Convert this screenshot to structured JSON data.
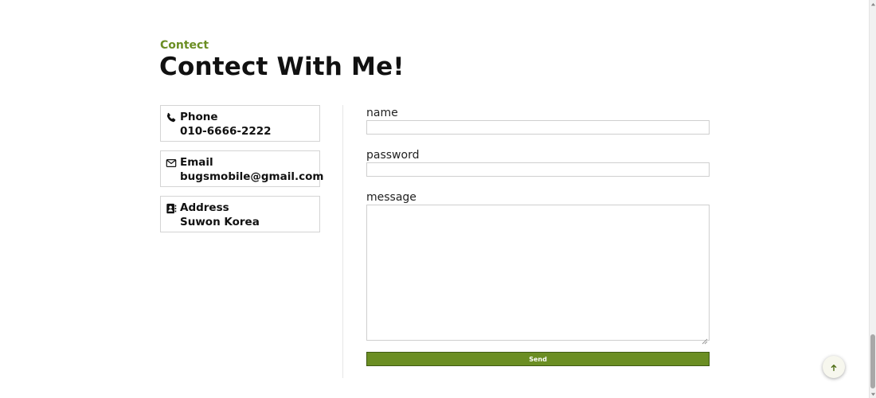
{
  "section": {
    "eyebrow": "Contect",
    "title": "Contect With Me!"
  },
  "contact_cards": [
    {
      "icon": "phone-icon",
      "label": "Phone",
      "value": "010-6666-2222"
    },
    {
      "icon": "envelope-icon",
      "label": "Email",
      "value": "bugsmobile@gmail.com"
    },
    {
      "icon": "address-book-icon",
      "label": "Address",
      "value": "Suwon Korea"
    }
  ],
  "form": {
    "name_label": "name",
    "name_value": "",
    "password_label": "password",
    "password_value": "",
    "message_label": "message",
    "message_value": "",
    "send_label": "Send"
  },
  "scroll_top_button": {
    "icon": "arrow-up-icon"
  },
  "colors": {
    "accent": "#6b8e23",
    "accent_border": "#3f5a13",
    "text": "#111111",
    "card_border": "#d4d4d4"
  }
}
